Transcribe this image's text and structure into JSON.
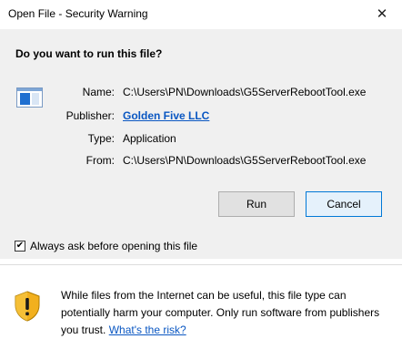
{
  "window": {
    "title": "Open File - Security Warning",
    "close_glyph": "✕"
  },
  "dialog": {
    "heading": "Do you want to run this file?",
    "fields": [
      {
        "label": "Name:",
        "value": "C:\\Users\\PN\\Downloads\\G5ServerRebootTool.exe"
      },
      {
        "label": "Publisher:",
        "value": "Golden Five LLC"
      },
      {
        "label": "Type:",
        "value": "Application"
      },
      {
        "label": "From:",
        "value": "C:\\Users\\PN\\Downloads\\G5ServerRebootTool.exe"
      }
    ],
    "buttons": {
      "run": "Run",
      "cancel": "Cancel"
    },
    "checkbox": {
      "label": "Always ask before opening this file",
      "checked": true,
      "check_glyph": "✔"
    }
  },
  "footer": {
    "warning_text": "While files from the Internet can be useful, this file type can potentially harm your computer. Only run software from publishers you trust.",
    "link_text": "What's the risk?"
  },
  "icons": {
    "file": "application-file-icon",
    "shield": "security-shield-icon"
  }
}
